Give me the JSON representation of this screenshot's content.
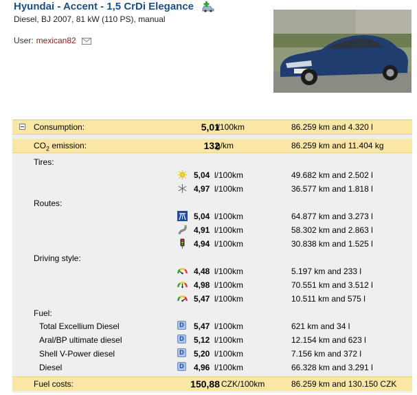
{
  "header": {
    "title": "Hyundai - Accent - 1,5 CrDi Elegance",
    "subtitle": "Diesel, BJ 2007, 81 kW (110 PS), manual",
    "user_label": "User:",
    "user_name": "mexican82"
  },
  "summary": {
    "consumption": {
      "label": "Consumption:",
      "value": "5,01",
      "unit": "l/100km",
      "detail": "86.259 km and 4.320 l"
    },
    "co2": {
      "label_prefix": "CO",
      "label_sub": "2",
      "label_suffix": " emission:",
      "value": "132",
      "unit": "g/km",
      "detail": "86.259 km and 11.404 kg"
    },
    "fuel_costs": {
      "label": "Fuel costs:",
      "value": "150,88",
      "unit": "CZK/100km",
      "detail": "86.259 km and 130.150 CZK"
    }
  },
  "tires": {
    "label": "Tires:",
    "rows": [
      {
        "icon": "sun-icon",
        "value": "5,04",
        "unit": "l/100km",
        "detail": "49.682 km and 2.502 l"
      },
      {
        "icon": "snowflake-icon",
        "value": "4,97",
        "unit": "l/100km",
        "detail": "36.577 km and 1.818 l"
      }
    ]
  },
  "routes": {
    "label": "Routes:",
    "rows": [
      {
        "icon": "motorway-icon",
        "value": "5,04",
        "unit": "l/100km",
        "detail": "64.877 km and 3.273 l"
      },
      {
        "icon": "country-road-icon",
        "value": "4,91",
        "unit": "l/100km",
        "detail": "58.302 km and 2.863 l"
      },
      {
        "icon": "traffic-light-icon",
        "value": "4,94",
        "unit": "l/100km",
        "detail": "30.838 km and 1.525 l"
      }
    ]
  },
  "driving_style": {
    "label": "Driving style:",
    "rows": [
      {
        "icon": "gauge-low-icon",
        "value": "4,48",
        "unit": "l/100km",
        "detail": "5.197 km and 233 l"
      },
      {
        "icon": "gauge-mid-icon",
        "value": "4,98",
        "unit": "l/100km",
        "detail": "70.551 km and 3.512 l"
      },
      {
        "icon": "gauge-high-icon",
        "value": "5,47",
        "unit": "l/100km",
        "detail": "10.511 km and 575 l"
      }
    ]
  },
  "fuel": {
    "label": "Fuel:",
    "badge": "D",
    "rows": [
      {
        "name": "Total Excellium Diesel",
        "value": "5,47",
        "unit": "l/100km",
        "detail": "621 km and 34 l"
      },
      {
        "name": "Aral/BP ultimate diesel",
        "value": "5,12",
        "unit": "l/100km",
        "detail": "12.154 km and 623 l"
      },
      {
        "name": "Shell V-Power diesel",
        "value": "5,20",
        "unit": "l/100km",
        "detail": "7.156 km and 372 l"
      },
      {
        "name": "Diesel",
        "value": "4,96",
        "unit": "l/100km",
        "detail": "66.328 km and 3.291 l"
      }
    ]
  }
}
